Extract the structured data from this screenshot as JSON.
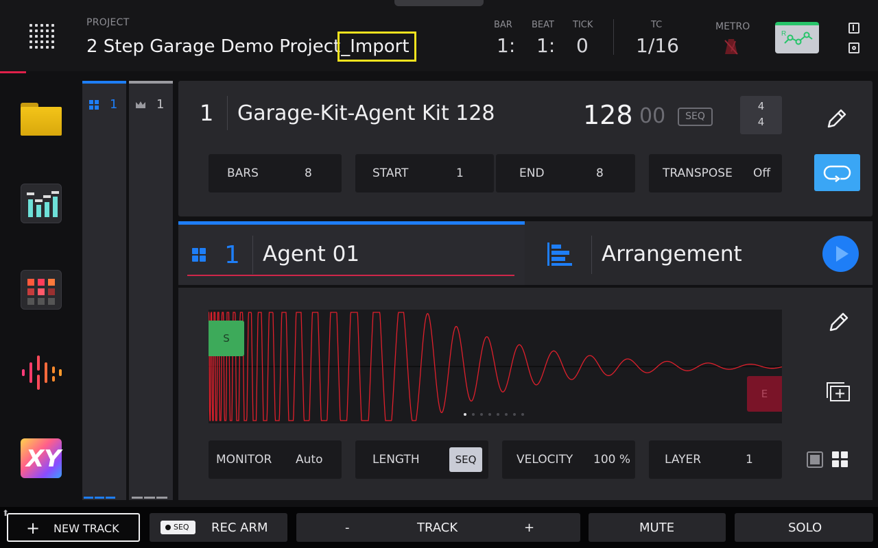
{
  "header": {
    "project_label": "PROJECT",
    "project_name": "2 Step Garage Demo Project",
    "project_suffix": "_Import",
    "position": {
      "bar_label": "BAR",
      "bar_value": "1:",
      "beat_label": "BEAT",
      "beat_value": "1:",
      "tick_label": "TICK",
      "tick_value": "0"
    },
    "tc_label": "TC",
    "tc_value": "1/16",
    "metro_label": "METRO",
    "automation_letter": "R"
  },
  "strips": [
    {
      "number": "1",
      "color": "#1e7ef7"
    },
    {
      "number": "1",
      "color": "#9a9aa0"
    }
  ],
  "sequence": {
    "number": "1",
    "name": "Garage-Kit-Agent Kit 128",
    "bpm": "128",
    "bpm_fraction": "00",
    "mode_badge": "SEQ",
    "timesig_top": "4",
    "timesig_bottom": "4",
    "bars_label": "BARS",
    "bars_value": "8",
    "start_label": "START",
    "start_value": "1",
    "end_label": "END",
    "end_value": "8",
    "transpose_label": "TRANSPOSE",
    "transpose_value": "Off"
  },
  "track": {
    "number": "1",
    "name": "Agent 01",
    "arrangement_label": "Arrangement"
  },
  "sample": {
    "start_marker": "S",
    "end_marker": "E",
    "waveform_color": "#e0202c",
    "page_count": 8,
    "page_active": 1
  },
  "params": {
    "monitor_label": "MONITOR",
    "monitor_value": "Auto",
    "length_label": "LENGTH",
    "length_value": "SEQ",
    "velocity_label": "VELOCITY",
    "velocity_value": "100 %",
    "layer_label": "LAYER",
    "layer_value": "1"
  },
  "bottom": {
    "new_track": "NEW TRACK",
    "rec_arm_badge": "SEQ",
    "rec_arm": "REC ARM",
    "track_minus": "-",
    "track": "TRACK",
    "track_plus": "+",
    "mute": "MUTE",
    "solo": "SOLO"
  },
  "colors": {
    "accent_blue": "#1e7ef7",
    "highlight_yellow": "#f4e31e",
    "loop_blue": "#3aa6f5",
    "start_green": "#3daa5a",
    "end_red": "#7a1428"
  }
}
